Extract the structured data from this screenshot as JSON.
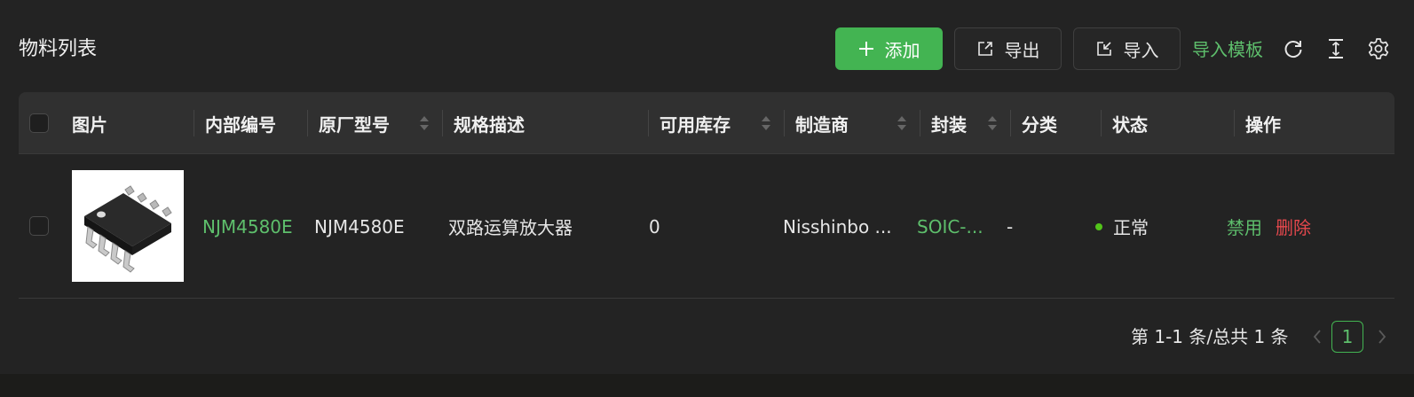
{
  "card": {
    "title": "物料列表"
  },
  "toolbar": {
    "add_label": "添加",
    "export_label": "导出",
    "import_label": "导入",
    "template_link": "导入模板",
    "icons": [
      "plus-icon",
      "export-icon",
      "import-icon",
      "reload-icon",
      "column-height-icon",
      "setting-icon"
    ]
  },
  "table": {
    "columns": {
      "image": "图片",
      "internal_code": "内部编号",
      "mfr_part": "原厂型号",
      "spec": "规格描述",
      "stock": "可用库存",
      "manufacturer": "制造商",
      "package": "封装",
      "category": "分类",
      "status": "状态",
      "actions": "操作"
    },
    "rows": [
      {
        "internal_code": "NJM4580E",
        "mfr_part": "NJM4580E",
        "spec": "双路运算放大器",
        "stock": "0",
        "manufacturer": "Nisshinbo ...",
        "package": "SOIC-...",
        "category": "-",
        "status": "正常",
        "action_disable": "禁用",
        "action_delete": "删除"
      }
    ]
  },
  "pagination": {
    "total_text": "第 1-1 条/总共 1 条",
    "current_page": "1"
  },
  "colors": {
    "accent": "#43b452",
    "link": "#5ebf6c",
    "danger": "#e5484d",
    "status_ok": "#52c41a",
    "background": "#232323",
    "header": "#303030"
  }
}
